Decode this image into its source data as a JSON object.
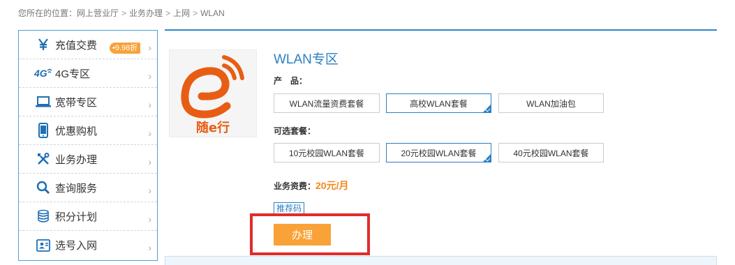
{
  "breadcrumb": {
    "prefix": "您所在的位置：",
    "items": [
      "网上营业厅",
      "业务办理",
      "上网",
      "WLAN"
    ],
    "separator": ">"
  },
  "sidebar": {
    "items": [
      {
        "label": "充值交费",
        "icon": "yen-icon",
        "badge": "•9.98折"
      },
      {
        "label": "4G专区",
        "icon": "4g-icon"
      },
      {
        "label": "宽带专区",
        "icon": "laptop-icon"
      },
      {
        "label": "优惠购机",
        "icon": "phone-icon"
      },
      {
        "label": "业务办理",
        "icon": "tools-icon"
      },
      {
        "label": "查询服务",
        "icon": "search-icon"
      },
      {
        "label": "积分计划",
        "icon": "database-icon"
      },
      {
        "label": "选号入网",
        "icon": "id-card-icon"
      }
    ],
    "arrow": "›"
  },
  "product": {
    "title": "WLAN专区",
    "logo_text": "随e行",
    "logo_alt": "e-logo-icon"
  },
  "form": {
    "product_label": "产　品：",
    "products": [
      {
        "label": "WLAN流量资费套餐",
        "selected": false
      },
      {
        "label": "高校WLAN套餐",
        "selected": true
      },
      {
        "label": "WLAN加油包",
        "selected": false
      }
    ],
    "package_label": "可选套餐：",
    "packages": [
      {
        "label": "10元校园WLAN套餐",
        "selected": false
      },
      {
        "label": "20元校园WLAN套餐",
        "selected": true
      },
      {
        "label": "40元校园WLAN套餐",
        "selected": false
      }
    ],
    "fee_label": "业务资费：",
    "fee_value": "20元/月",
    "referral_label": "推荐码",
    "submit_label": "办理"
  },
  "colors": {
    "accent": "#2b7fc2",
    "orange": "#f8a237",
    "highlight": "#e22b2b"
  }
}
